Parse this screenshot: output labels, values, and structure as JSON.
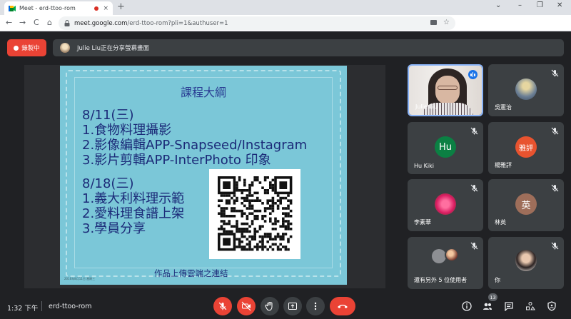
{
  "browser": {
    "tab_title": "Meet - erd-ttoo-rom",
    "tab_close": "×",
    "new_tab": "+",
    "window_controls": [
      "⌄",
      "–",
      "❐",
      "✕"
    ],
    "url_host": "meet.google.com",
    "url_path": "/erd-ttoo-rom?pli=1&authuser=1",
    "back": "←",
    "forward": "→",
    "reload": "C",
    "home": "⌂",
    "star": "☆",
    "menu": "⋮"
  },
  "meeting": {
    "recording_label": "錄製中",
    "presenting_text": "Julie Liu正在分享螢幕畫面"
  },
  "slide": {
    "heading": "課程大綱",
    "lines": [
      "8/11(三)",
      "1.食物料理攝影",
      "2.影像編輯APP-Snapseed/Instagram",
      "3.影片剪輯APP-InterPhoto 印象",
      "8/18(三)",
      "1.義大利料理示範",
      "2.愛料理食譜上架",
      "3.學員分享"
    ],
    "footer": "作品上傳雲端之連結",
    "stamp": "2016年8月11日 星期三"
  },
  "participants": [
    {
      "name": "Julie Liu",
      "type": "video",
      "speaking": true
    },
    {
      "name": "吳憲治",
      "type": "photo",
      "muted": true,
      "avatar_color": "#6b7f95"
    },
    {
      "name": "Hu Kiki",
      "type": "initials",
      "initials": "Hu",
      "muted": true,
      "avatar_color": "#0b8043"
    },
    {
      "name": "楊雅評",
      "type": "initials",
      "initials": "雅評",
      "muted": true,
      "avatar_color": "#e8532f"
    },
    {
      "name": "李素華",
      "type": "photo",
      "muted": true,
      "avatar_color": "#e0467a"
    },
    {
      "name": "林英",
      "type": "initials",
      "initials": "英",
      "muted": true,
      "avatar_color": "#9e6e5a"
    },
    {
      "name": "還有另外 5 位使用者",
      "type": "group",
      "muted": true
    },
    {
      "name": "你",
      "type": "photo",
      "muted": true,
      "avatar_color": "#e9e3de"
    }
  ],
  "bottom": {
    "time": "1:32 下午",
    "meeting_code": "erd-ttoo-rom",
    "participant_count": "13"
  }
}
